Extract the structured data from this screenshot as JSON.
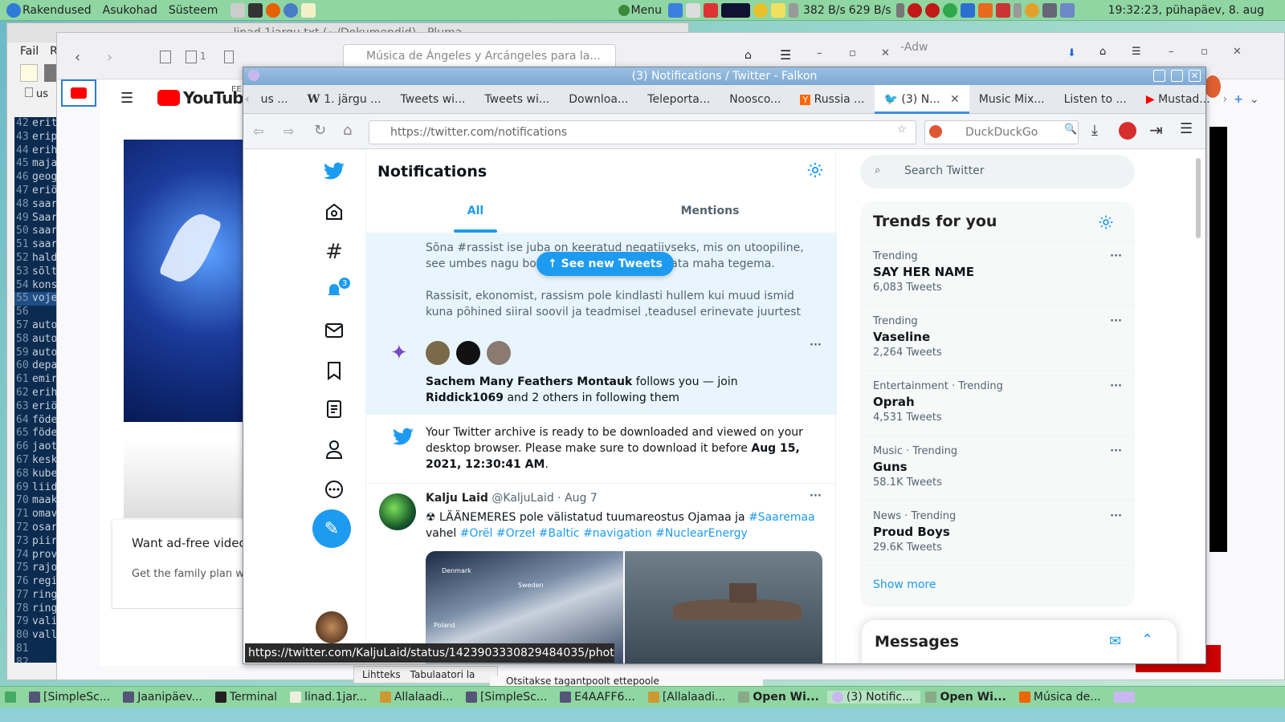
{
  "top_panel": {
    "menus": [
      "Rakendused",
      "Asukohad",
      "Süsteem"
    ],
    "menu_label": "Menu",
    "net_down": "382 B/s",
    "net_up": "629 B/s",
    "clock": "19:32:23, pühapäev,  8. aug"
  },
  "pluma": {
    "title": "linad.1jargu.txt (~/Dokumendid) - Pluma",
    "menu": [
      "Fail",
      "Re"
    ],
    "tab_label": "us",
    "lines": [
      [
        "42",
        "erit"
      ],
      [
        "43",
        "erip"
      ],
      [
        "44",
        "erih"
      ],
      [
        "45",
        "maja"
      ],
      [
        "46",
        "geog"
      ],
      [
        "47",
        "eriö"
      ],
      [
        "48",
        "saar"
      ],
      [
        "49",
        "Saar"
      ],
      [
        "50",
        "saar"
      ],
      [
        "51",
        "saar"
      ],
      [
        "52",
        "hald"
      ],
      [
        "53",
        "sõlt"
      ],
      [
        "54",
        "kons"
      ],
      [
        "55",
        "voje"
      ],
      [
        "56",
        ""
      ],
      [
        "57",
        "auto"
      ],
      [
        "58",
        "auto"
      ],
      [
        "59",
        "auto"
      ],
      [
        "60",
        "depa"
      ],
      [
        "61",
        "emir"
      ],
      [
        "62",
        "erih"
      ],
      [
        "63",
        "eriö"
      ],
      [
        "64",
        "föde"
      ],
      [
        "65",
        "föde"
      ],
      [
        "66",
        "jaot"
      ],
      [
        "67",
        "kesk"
      ],
      [
        "68",
        "kube"
      ],
      [
        "69",
        "liid"
      ],
      [
        "70",
        "maak"
      ],
      [
        "71",
        "omav"
      ],
      [
        "72",
        "osar"
      ],
      [
        "73",
        "piir"
      ],
      [
        "74",
        "prov"
      ],
      [
        "75",
        "rajo"
      ],
      [
        "76",
        "regi"
      ],
      [
        "77",
        "ring"
      ],
      [
        "78",
        "ring"
      ],
      [
        "79",
        "vali"
      ],
      [
        "80",
        "vall"
      ],
      [
        "81",
        ""
      ],
      [
        "82",
        ""
      ]
    ]
  },
  "firefox": {
    "tab_partial": "-Adw",
    "page_title": "Música de Ángeles y Arcángeles para la...",
    "tab_count": "1",
    "yt_logo": "YouTube",
    "yt_region": "EE",
    "promo_title": "Want ad-free videos",
    "promo_sub": "Get the family plan wit",
    "status_bar_items": [
      "Lihtteks",
      "Tabulaatori la"
    ],
    "bottom_text": "Otsitakse tagantpoolt ettepoole"
  },
  "falkon": {
    "title": "(3) Notifications / Twitter - Falkon",
    "tabs": [
      "us ...",
      "1. järgu ...",
      "Tweets wi...",
      "Tweets wi...",
      "Downloa...",
      "Teleporta...",
      "Noosco...",
      "Russia ...",
      "(3) N...",
      "Music Mix...",
      "Listen to ...",
      "Mustad..."
    ],
    "url": "https://twitter.com/notifications",
    "search_placeholder": "DuckDuckGo",
    "status_url": "https://twitter.com/KaljuLaid/status/1423903330829484035/photo/2"
  },
  "twitter": {
    "header": "Notifications",
    "tabs": [
      "All",
      "Mentions"
    ],
    "notif_badge": "3",
    "see_new": "See new Tweets",
    "text_block": "Sõna #rassist ise juba on keeratud negatiivseks, mis on utoopiline, see umbes nagu bota... matemaatikuid hakata maha tegema.",
    "text_block2": "Rassisit, ekonomist, rassism pole kindlasti hullem kui muud ismid kuna põhined siiral soovil ja teadmisel ,teadusel erinevate juurtest",
    "follow": {
      "name1": "Sachem Many Feathers Montauk",
      "mid": " follows you — join ",
      "name2": "Riddick1069",
      "tail": " and 2 others in following them"
    },
    "archive": {
      "text": "Your Twitter archive is ready to be downloaded and viewed on your desktop browser. Please make sure to download it before ",
      "date": "Aug 15, 2021, 12:30:41 AM",
      "end": "."
    },
    "tweet": {
      "name": "Kalju Laid",
      "handle": "@KaljuLaid",
      "date": "· Aug 7",
      "text": "☢ LÄÄNEMERES pole välistatud tuumareostus Ojamaa ja ",
      "tag1": "#Saaremaa",
      "text2": "vahel ",
      "tags": "#Orël #Orzeł #Baltic #navigation #NuclearEnergy",
      "map_labels": [
        "Denmark",
        "Sweden",
        "Poland"
      ]
    },
    "search_placeholder": "Search Twitter",
    "trends_title": "Trends for you",
    "trends": [
      {
        "cat": "Trending",
        "name": "SAY HER NAME",
        "cnt": "6,083 Tweets"
      },
      {
        "cat": "Trending",
        "name": "Vaseline",
        "cnt": "2,264 Tweets"
      },
      {
        "cat": "Entertainment · Trending",
        "name": "Oprah",
        "cnt": "4,531 Tweets"
      },
      {
        "cat": "Music · Trending",
        "name": "Guns",
        "cnt": "58.1K Tweets"
      },
      {
        "cat": "News · Trending",
        "name": "Proud Boys",
        "cnt": "29.6K Tweets"
      }
    ],
    "show_more": "Show more",
    "messages": "Messages"
  },
  "taskbar": [
    {
      "label": "[SimpleSc..."
    },
    {
      "label": "Jaanipäev..."
    },
    {
      "label": "Terminal"
    },
    {
      "label": "linad.1jar..."
    },
    {
      "label": "Allalaadi..."
    },
    {
      "label": "[SimpleSc..."
    },
    {
      "label": "E4AAFF6..."
    },
    {
      "label": "[Allalaadi..."
    },
    {
      "label": "Open Wi..."
    },
    {
      "label": "(3) Notific..."
    },
    {
      "label": "Open Wi..."
    },
    {
      "label": "Música de..."
    }
  ]
}
